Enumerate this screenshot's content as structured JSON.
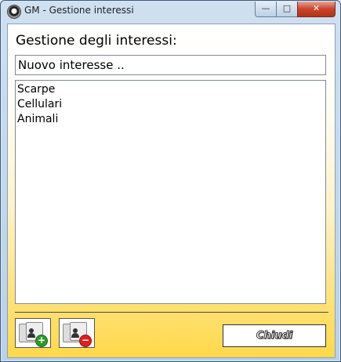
{
  "window": {
    "title": "GM - Gestione interessi",
    "controls": {
      "minimize": "—",
      "maximize": "□",
      "close": "✕"
    }
  },
  "main": {
    "heading": "Gestione degli interessi:",
    "input_value": "Nuovo interesse ..",
    "interests": [
      "Scarpe",
      "Cellulari",
      "Animali"
    ]
  },
  "footer": {
    "add_icon": "add-interest-icon",
    "remove_icon": "remove-interest-icon",
    "close_label": "Chiudi"
  },
  "colors": {
    "titlebar": "#b9d1ea",
    "client_gradient_top": "#ffffff",
    "client_gradient_bottom": "#ffd94a",
    "add_badge": "#2a9a2a",
    "remove_badge": "#e02020"
  }
}
